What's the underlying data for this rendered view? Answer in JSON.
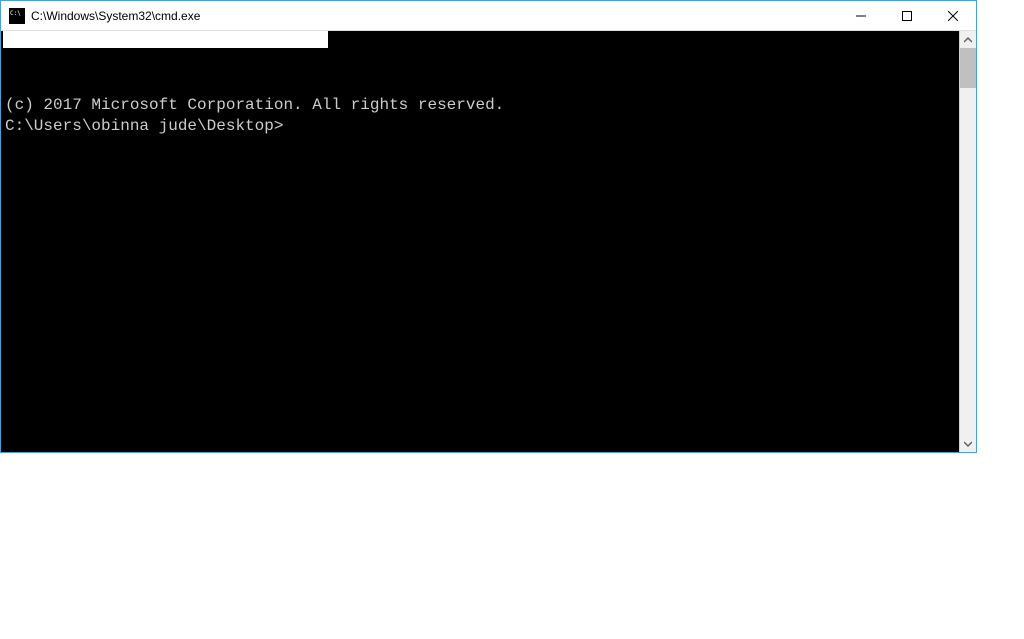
{
  "window": {
    "title": "C:\\Windows\\System32\\cmd.exe"
  },
  "terminal": {
    "line1_redacted_partial": "",
    "copyright": "(c) 2017 Microsoft Corporation. All rights reserved.",
    "blank": "",
    "prompt": "C:\\Users\\obinna jude\\Desktop>"
  }
}
